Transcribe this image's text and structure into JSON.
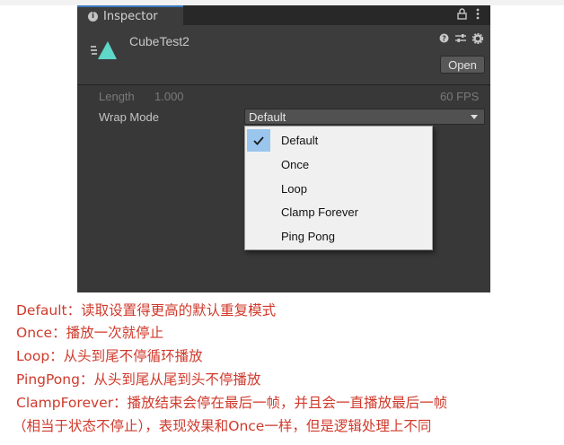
{
  "window": {
    "tab_title": "Inspector",
    "tab_icon": "info-icon",
    "tab_actions": [
      "lock-icon",
      "kebab-menu-icon"
    ]
  },
  "asset": {
    "name": "CubeTest2",
    "icon": "animation-clip-icon",
    "header_icons": [
      "help-icon",
      "presets-icon",
      "settings-icon"
    ],
    "open_label": "Open"
  },
  "properties": {
    "length_label": "Length",
    "length_value": "1.000",
    "fps": "60 FPS",
    "wrap_mode_label": "Wrap Mode",
    "wrap_mode_value": "Default"
  },
  "dropdown": {
    "options": [
      "Default",
      "Once",
      "Loop",
      "Clamp Forever",
      "Ping Pong"
    ],
    "selected": "Default"
  },
  "notes": [
    "Default：读取设置得更高的默认重复模式",
    "Once：播放一次就停止",
    "Loop：从头到尾不停循环播放",
    "PingPong：从头到尾从尾到头不停播放",
    "ClampForever：播放结束会停在最后一帧，并且会一直播放最后一帧",
    "（相当于状态不停止），表现效果和Once一样，但是逻辑处理上不同"
  ],
  "colors": {
    "note_text": "#d03a2c",
    "panel_bg": "#383838",
    "selection": "#9ac6ee",
    "asset_icon": "#5ed8c8"
  }
}
